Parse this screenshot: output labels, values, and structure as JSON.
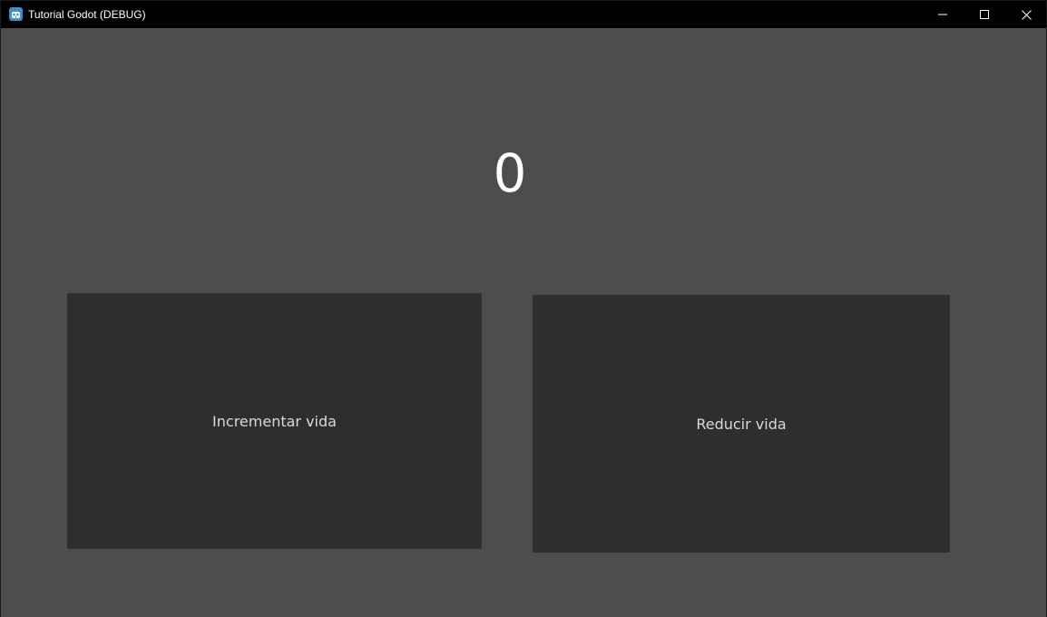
{
  "window": {
    "title": "Tutorial Godot (DEBUG)",
    "app_icon": "godot-icon",
    "controls": {
      "minimize": "minimize-icon",
      "maximize": "maximize-icon",
      "close": "close-icon"
    }
  },
  "main": {
    "counter_value": "0",
    "increment_label": "Incrementar vida",
    "decrement_label": "Reducir vida"
  },
  "colors": {
    "background": "#4d4d4d",
    "titlebar": "#000000",
    "button": "#2e2e2e",
    "counter_text": "#ffffff",
    "button_text": "#d9d9d9"
  }
}
